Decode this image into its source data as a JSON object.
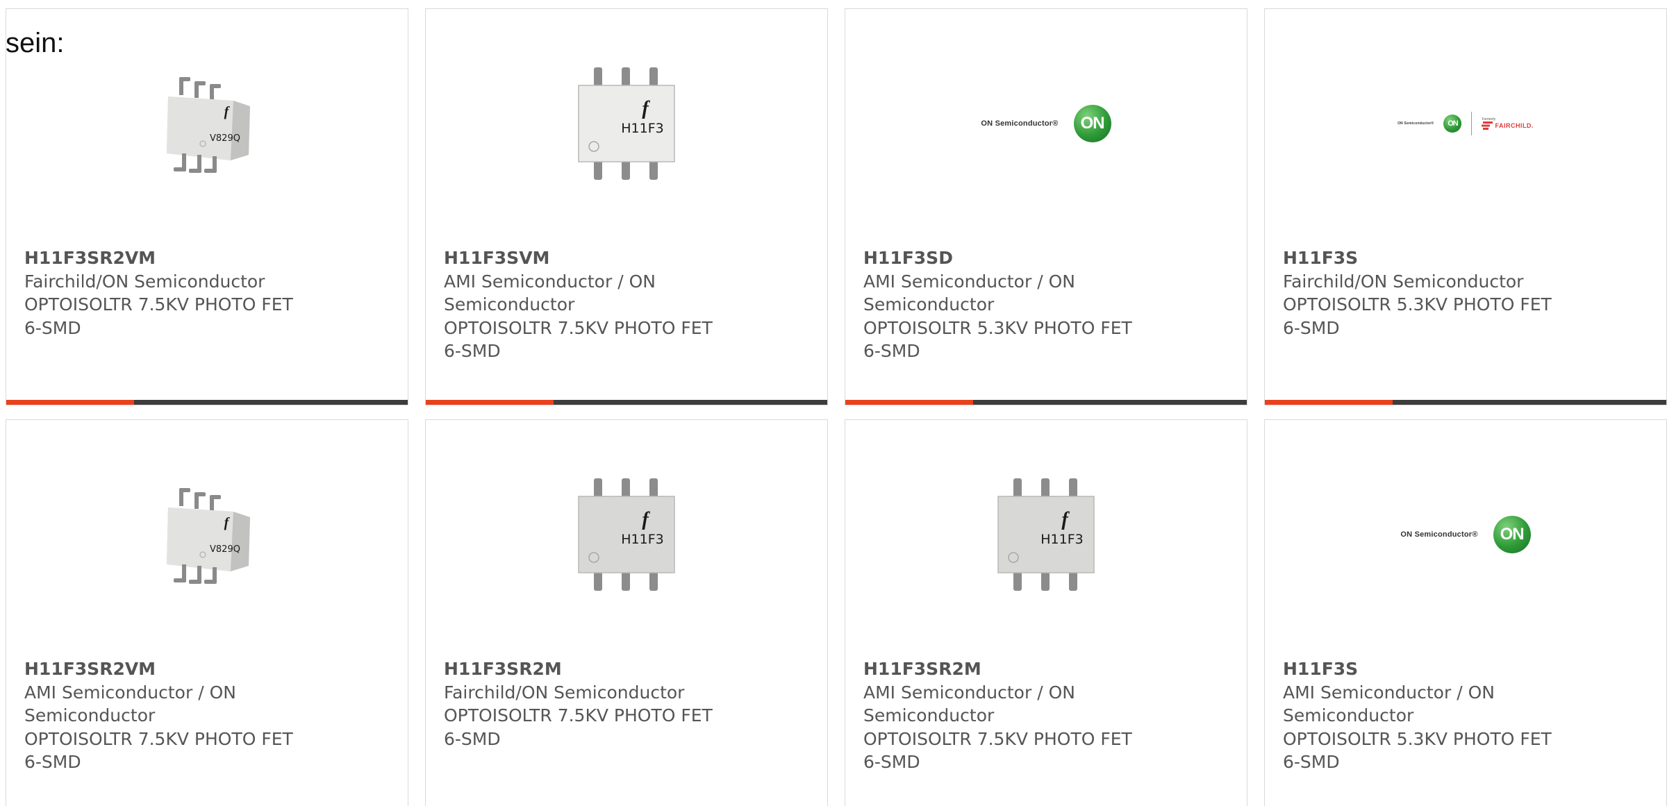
{
  "page_label": "sein:",
  "cards": [
    {
      "part_number": "H11F3SR2VM",
      "manufacturer": "Fairchild/ON Semiconductor",
      "description": "OPTOISOLTR 7.5KV PHOTO FET",
      "package": "6-SMD",
      "image": "angled-chip-photo"
    },
    {
      "part_number": "H11F3SVM",
      "manufacturer": "AMI Semiconductor / ON Semiconductor",
      "description": "OPTOISOLTR 7.5KV PHOTO FET",
      "package": "6-SMD",
      "image": "top-chip-photo-white"
    },
    {
      "part_number": "H11F3SD",
      "manufacturer": "AMI Semiconductor / ON Semiconductor",
      "description": "OPTOISOLTR 5.3KV PHOTO FET",
      "package": "6-SMD",
      "image": "on-semiconductor-logo"
    },
    {
      "part_number": "H11F3S",
      "manufacturer": "Fairchild/ON Semiconductor",
      "description": "OPTOISOLTR 5.3KV PHOTO FET",
      "package": "6-SMD",
      "image": "on-fairchild-logo"
    },
    {
      "part_number": "H11F3SR2VM",
      "manufacturer": "AMI Semiconductor / ON Semiconductor",
      "description": "OPTOISOLTR 7.5KV PHOTO FET",
      "package": "6-SMD",
      "image": "angled-chip-photo"
    },
    {
      "part_number": "H11F3SR2M",
      "manufacturer": "Fairchild/ON Semiconductor",
      "description": "OPTOISOLTR 7.5KV PHOTO FET",
      "package": "6-SMD",
      "image": "top-chip-photo-gray"
    },
    {
      "part_number": "H11F3SR2M",
      "manufacturer": "AMI Semiconductor / ON Semiconductor",
      "description": "OPTOISOLTR 7.5KV PHOTO FET",
      "package": "6-SMD",
      "image": "top-chip-photo-gray"
    },
    {
      "part_number": "H11F3S",
      "manufacturer": "AMI Semiconductor / ON Semiconductor",
      "description": "OPTOISOLTR 5.3KV PHOTO FET",
      "package": "6-SMD",
      "image": "on-semiconductor-logo"
    }
  ],
  "chip_markings": {
    "angled": "V829Q",
    "top": "H11F3",
    "brand_glyph": "f"
  },
  "logos": {
    "on_text": "ON Semiconductor",
    "registered": "®",
    "on_circle": "ON",
    "formerly": "Formerly",
    "fairchild": "FAIRCHILD."
  },
  "colors": {
    "accent_bar": "#e8411c",
    "bar_dark": "#3d3d3d",
    "text": "#555555",
    "card_border": "#d9d9d9",
    "on_green": "#2e9a37",
    "fairchild_red": "#e23a37"
  }
}
